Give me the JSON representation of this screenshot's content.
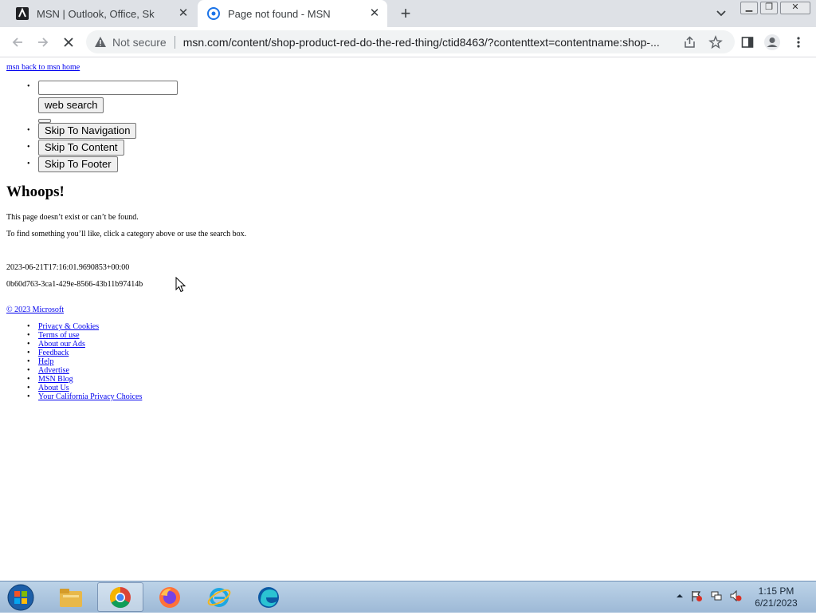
{
  "browser": {
    "tabs": [
      {
        "title": "MSN | Outlook, Office, Skype, Bing",
        "active": false
      },
      {
        "title": "Page not found - MSN",
        "active": true
      }
    ],
    "security_label": "Not secure",
    "url": "msn.com/content/shop-product-red-do-the-red-thing/ctid8463/?contenttext=contentname:shop-...",
    "window_controls": [
      "minimize",
      "restore",
      "close"
    ]
  },
  "page": {
    "back_link": "msn back to msn home",
    "search": {
      "value": "",
      "button_label": "web search"
    },
    "skip_buttons": [
      "Skip To Navigation",
      "Skip To Content",
      "Skip To Footer"
    ],
    "heading": "Whoops!",
    "message1": "This page doesn’t exist or can’t be found.",
    "message2": "To find something you’ll like, click a category above or use the search box.",
    "timestamp": "2023-06-21T17:16:01.9690853+00:00",
    "request_id": "0b60d763-3ca1-429e-8566-43b11b97414b",
    "copyright": "© 2023 Microsoft",
    "footer_links": [
      "Privacy & Cookies",
      "Terms of use",
      "About our Ads",
      "Feedback",
      "Help",
      "Advertise",
      "MSN Blog",
      "About Us",
      "Your California Privacy Choices"
    ]
  },
  "taskbar": {
    "apps": [
      "file-explorer",
      "chrome",
      "firefox",
      "internet-explorer",
      "edge"
    ],
    "active_app": "chrome",
    "time": "1:15 PM",
    "date": "6/21/2023"
  }
}
